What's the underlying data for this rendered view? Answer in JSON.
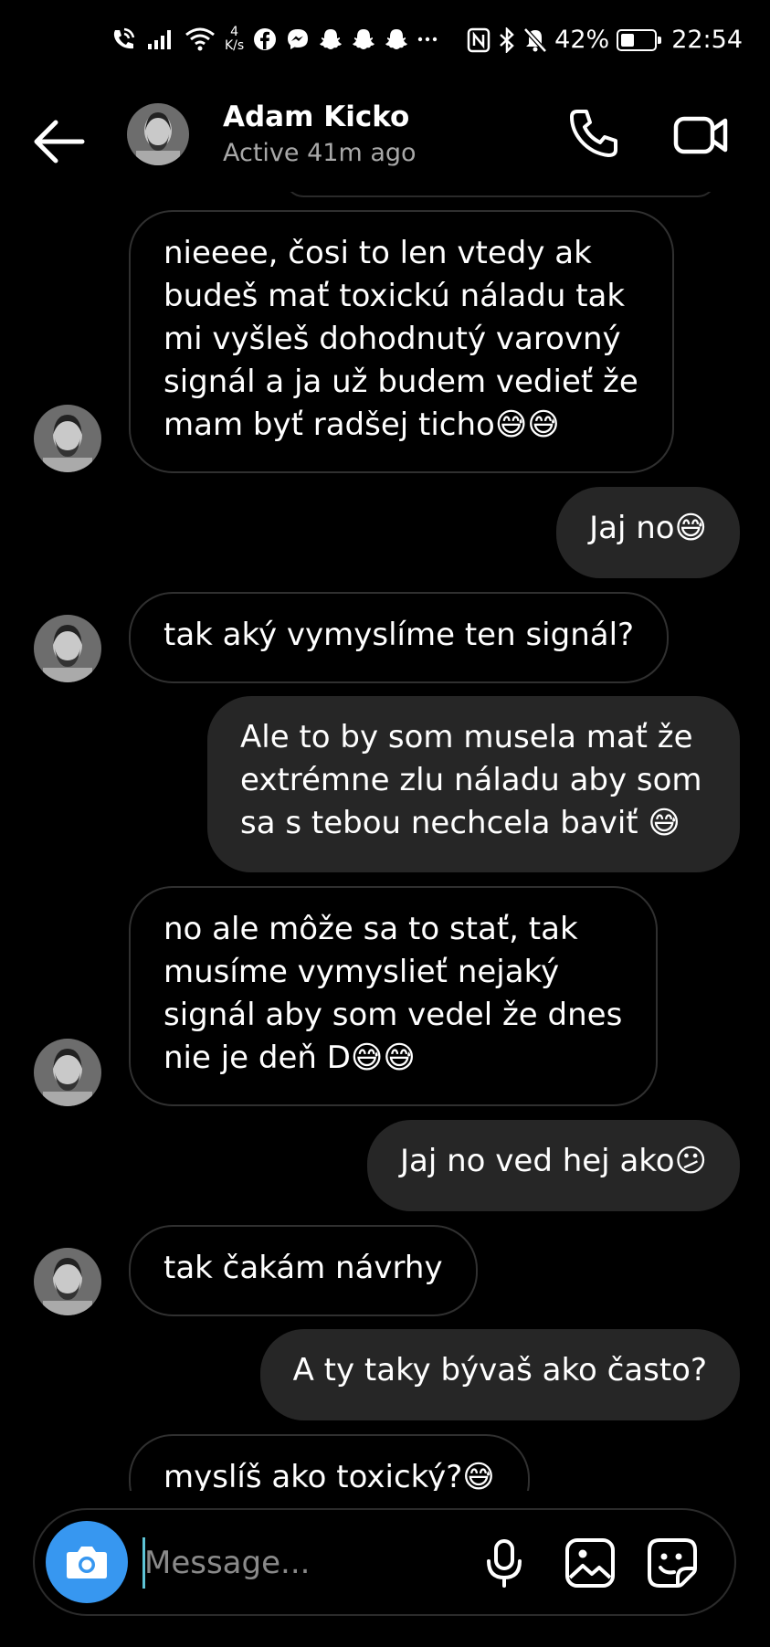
{
  "status_bar": {
    "net_speed_value": "4",
    "net_speed_unit": "K/s",
    "battery": "42%",
    "battery_level": 0.42,
    "time": "22:54",
    "left_icons": [
      "wifi-calling-icon",
      "signal-icon",
      "wifi-icon",
      "facebook-icon",
      "messenger-icon",
      "snapchat-icon",
      "snapchat-icon",
      "snapchat-icon",
      "more-icon"
    ],
    "right_icons": [
      "nfc-icon",
      "bluetooth-icon",
      "mute-icon",
      "battery-icon"
    ]
  },
  "header": {
    "name": "Adam Kicko",
    "status": "Active 41m ago"
  },
  "messages": [
    {
      "side": "in",
      "text_lines": [
        "nieeee, čosi to len vtedy ak",
        "budeš mať toxickú náladu tak",
        "mi vyšleš dohodnutý varovný",
        "signál a ja už budem vedieť že",
        "mam byť radšej ticho😅😅"
      ]
    },
    {
      "side": "out",
      "text_lines": [
        "Jaj no😅"
      ]
    },
    {
      "side": "in",
      "text_lines": [
        "tak aký vymyslíme ten signál?"
      ]
    },
    {
      "side": "out",
      "text_lines": [
        "Ale to by som musela mať že",
        "extrémne zlu náladu aby som",
        "sa s tebou nechcela baviť 😅"
      ]
    },
    {
      "side": "in",
      "text_lines": [
        "no ale môže sa to stať, tak",
        "musíme vymyslieť nejaký",
        "signál aby som vedel že dnes",
        "nie je deň D😅😅"
      ]
    },
    {
      "side": "out",
      "text_lines": [
        "Jaj no ved hej ako😕"
      ]
    },
    {
      "side": "in",
      "text_lines": [
        "tak čakám návrhy"
      ]
    },
    {
      "side": "out",
      "text_lines": [
        "A ty taky bývaš ako často?"
      ]
    },
    {
      "side": "in",
      "text_lines": [
        "myslíš ako toxický?😅"
      ]
    }
  ],
  "composer": {
    "placeholder": "Message..."
  },
  "colors": {
    "background": "#000000",
    "outgoing_bubble": "#262626",
    "incoming_border": "#303030",
    "camera_button": "#3797f0",
    "secondary_text": "#a8a8a8"
  }
}
